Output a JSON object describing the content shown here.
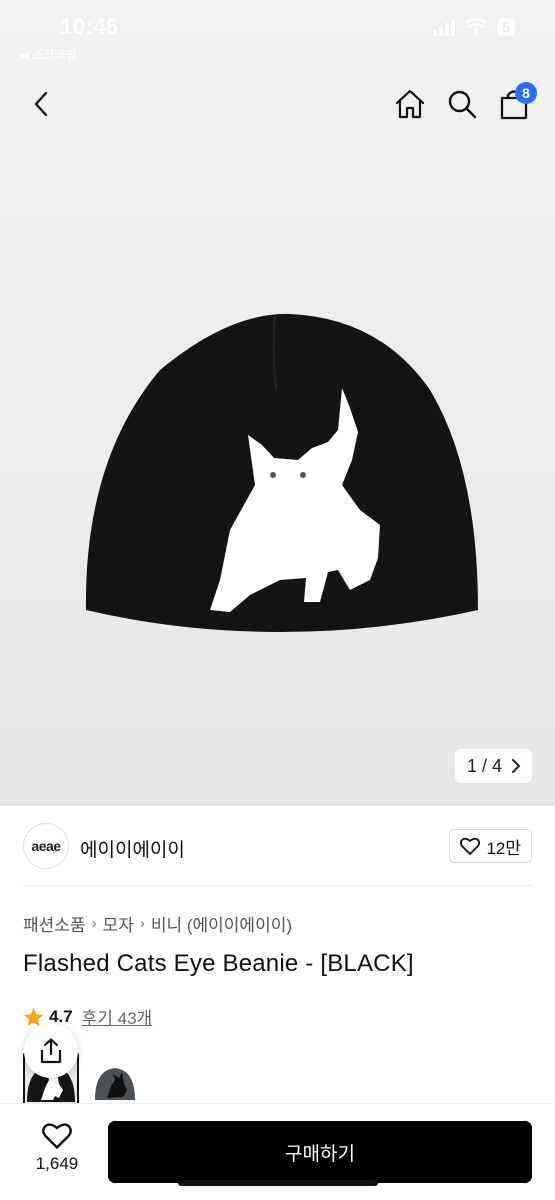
{
  "status_bar": {
    "time": "10:46",
    "back_app": "◀ 스크래핑",
    "battery": "5"
  },
  "header": {
    "cart_count": "8",
    "icons": [
      "back-icon",
      "home-icon",
      "search-icon",
      "cart-icon"
    ]
  },
  "gallery": {
    "counter": "1 / 4"
  },
  "brand": {
    "logo_text": "aeae",
    "name": "에이이에이이",
    "likes": "12만"
  },
  "breadcrumb": [
    "패션소품",
    "모자",
    "비니 (에이이에이이)"
  ],
  "product": {
    "title": "Flashed Cats Eye Beanie - [BLACK]",
    "rating": "4.7",
    "reviews": "후기 43개"
  },
  "bottom": {
    "wish_count": "1,649",
    "buy_label": "구매하기"
  },
  "colors": {
    "accent": "#2f6bff",
    "star": "#f7a516",
    "primary_button": "#000000"
  }
}
